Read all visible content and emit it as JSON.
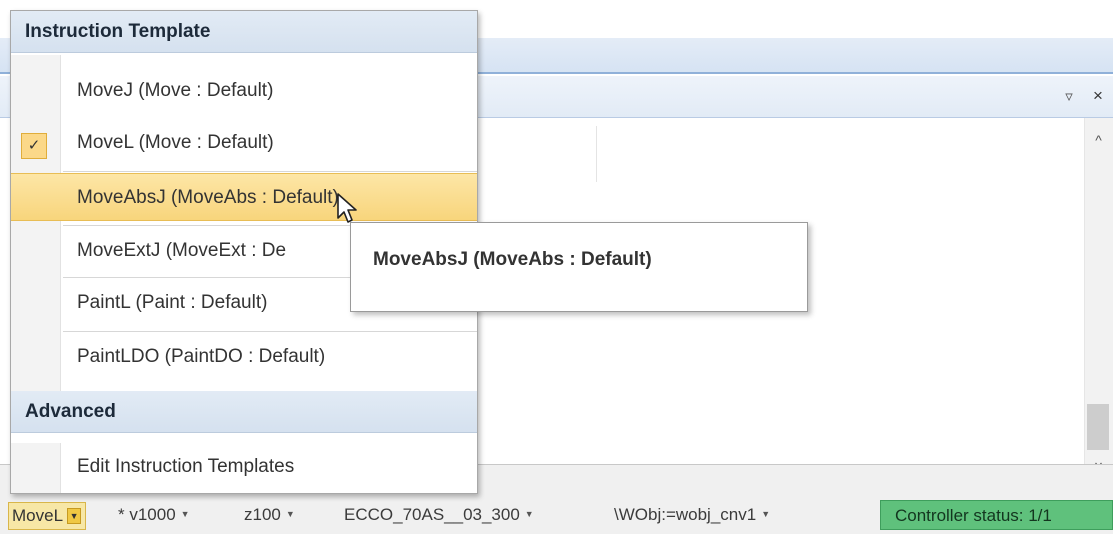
{
  "window": {
    "pin_glyph": "▿",
    "close_glyph": "×",
    "scroll_up_glyph": "^",
    "scroll_down_glyph": "∨"
  },
  "menu": {
    "section_instruction_template": "Instruction Template",
    "section_advanced": "Advanced",
    "items": [
      {
        "label": "MoveJ (Move : Default)",
        "checked": false
      },
      {
        "label": "MoveL (Move : Default)",
        "checked": true
      },
      {
        "label": "MoveAbsJ (MoveAbs : Default)",
        "checked": false
      },
      {
        "label": "MoveExtJ (MoveExt : De",
        "checked": false
      },
      {
        "label": "PaintL (Paint : Default)",
        "checked": false
      },
      {
        "label": "PaintLDO (PaintDO : Default)",
        "checked": false
      }
    ],
    "advanced_items": [
      {
        "label": "Edit Instruction Templates"
      }
    ],
    "checkmark_glyph": "✓"
  },
  "tooltip": {
    "text": "MoveAbsJ (MoveAbs : Default)"
  },
  "instruction_bar": {
    "instruction": "MoveL",
    "dropdown_glyph": "▼",
    "args": [
      "* v1000",
      "z100",
      "ECCO_70AS__03_300",
      "\\WObj:=wobj_cnv1"
    ],
    "arg_arrow_glyph": "▼",
    "controller_status": "Controller status: 1/1"
  },
  "colors": {
    "highlight": "#f8d57c",
    "section_header": "#d5e1ef",
    "status_green": "#5fc17c"
  }
}
